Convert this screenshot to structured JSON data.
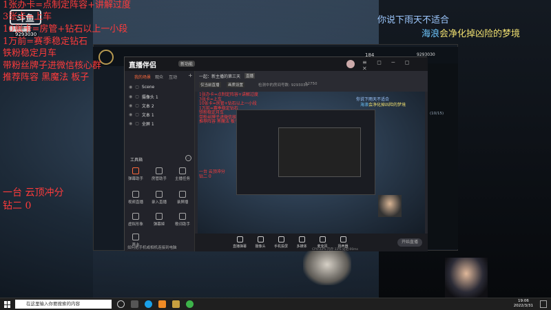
{
  "overlay_top_left": {
    "lines": [
      "1张办卡=点制定阵容+讲解过度",
      "3张卡=上车",
      "10张卡=房管+钻石以上一小段",
      "1万前=赛季稳定钻石",
      "铁粉稳定月车",
      "带粉丝牌子进微信核心群",
      "推荐阵容   黑魔法  板子"
    ],
    "logo": "斗鱼",
    "tag": "鱼塘",
    "room_number": "9293030"
  },
  "overlay_left_mid": {
    "line1": "一台 云顶冲分",
    "line2": "钻二  0"
  },
  "overlay_top_right": {
    "line1": "你说下雨天不适合",
    "line2_accent": "海浪",
    "line2_rest": "会净化掉凶险的梦境"
  },
  "game_client": {
    "counter": "184",
    "room": "9293030",
    "side_text": "(10/15)"
  },
  "obs": {
    "logo": "直播伴侣",
    "badge": "新功能",
    "tabs": [
      "我的场景",
      "观众",
      "互动"
    ],
    "scenes": [
      "Scene",
      "摄像头 1",
      "文本 2",
      "文本 1",
      "全屏 1"
    ],
    "tools_title": "工具箱",
    "tools": [
      "弹幕助手",
      "房管助手",
      "主播任务",
      "视频直播",
      "录入直播",
      "录屏播",
      "虚拟形象",
      "弹幕姬",
      "歌词助手",
      "声卡"
    ],
    "footer": "如何把手机或相机连接到电脑",
    "info_title": "一起：新主播的第三天",
    "info_badge": "直播",
    "info_sub1": "仅当前直播",
    "info_sub2": "画质设置",
    "info_stat1": "检测中的房间号数: 9293030",
    "info_stat2": "52750",
    "bottom_tools": [
      "直播弹幕",
      "摄像头",
      "手机投屏",
      "多媒体",
      "麦克风",
      "扬声器"
    ],
    "start_label": "开始直播",
    "stats": "CPU:22%  内存:33%  延迟:00ms"
  },
  "taskbar": {
    "search_placeholder": "在这里输入你要搜索的内容",
    "time": "19:06",
    "date": "2022/3/31"
  },
  "colors": {
    "overlay_red": "#ff3b3b",
    "obs_bg": "#1e1f24",
    "taskbar": "#1f1f1f"
  }
}
